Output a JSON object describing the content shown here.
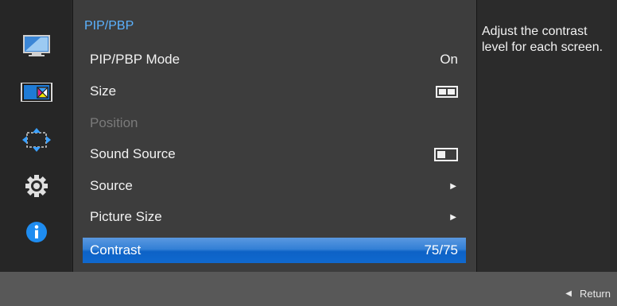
{
  "sidebar": {
    "items": [
      {
        "icon": "picture-icon"
      },
      {
        "icon": "pip-pbp-icon"
      },
      {
        "icon": "onscreen-display-icon"
      },
      {
        "icon": "system-gear-icon"
      },
      {
        "icon": "information-icon"
      }
    ]
  },
  "menu": {
    "title": "PIP/PBP",
    "items": [
      {
        "label": "PIP/PBP Mode",
        "value": "On"
      },
      {
        "label": "Size",
        "value_icon": "size-split-icon"
      },
      {
        "label": "Position"
      },
      {
        "label": "Sound Source",
        "value_icon": "sound-source-icon"
      },
      {
        "label": "Source",
        "value_icon": "triangle-right-icon"
      },
      {
        "label": "Picture Size",
        "value_icon": "triangle-right-icon"
      },
      {
        "label": "Contrast",
        "value": "75/75"
      }
    ]
  },
  "help": {
    "text": "Adjust the contrast level for each screen."
  },
  "footer": {
    "return_label": "Return"
  },
  "colors": {
    "accent": "#5bb2ff",
    "selected": "#1069cf",
    "panel": "#3d3d3d",
    "background": "#2b2b2b"
  }
}
